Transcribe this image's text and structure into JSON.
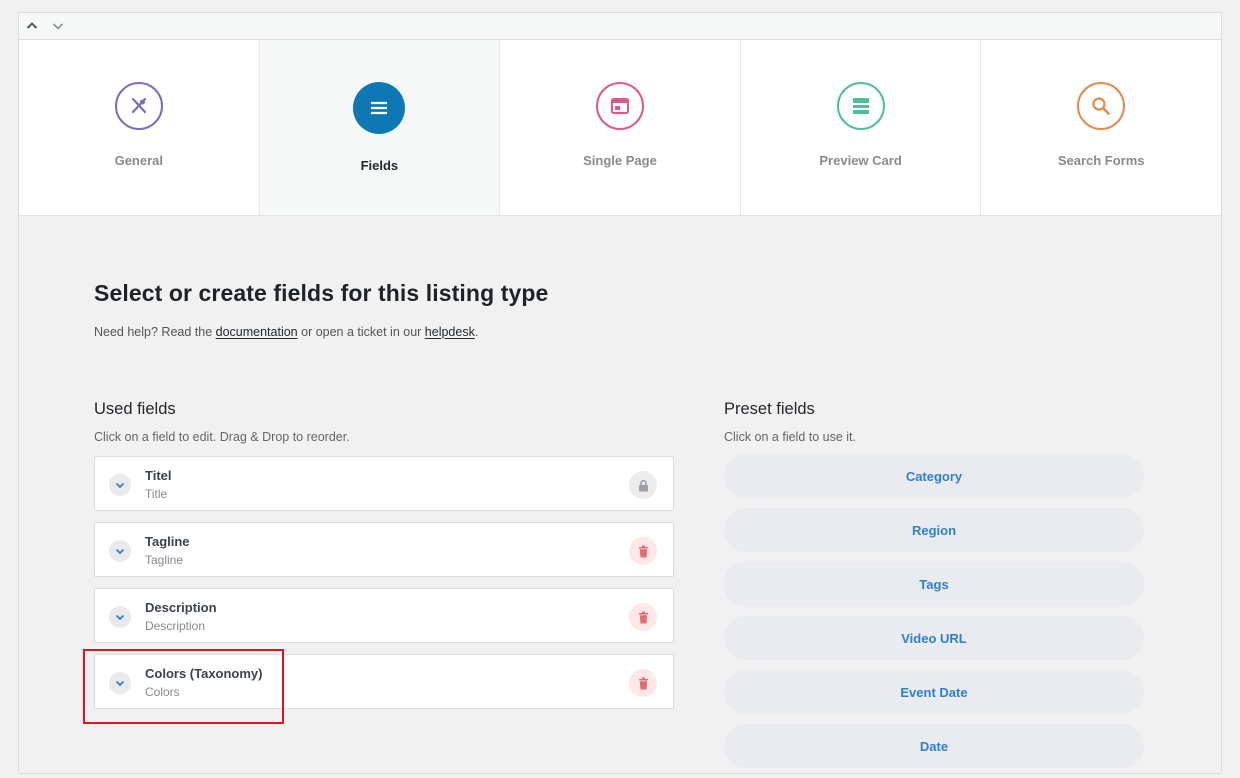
{
  "tabs": [
    {
      "label": "General",
      "icon": "utensils-icon",
      "color": "#7e6bc4",
      "active": false
    },
    {
      "label": "Fields",
      "icon": "list-icon",
      "color": "#0e78b4",
      "active": true
    },
    {
      "label": "Single Page",
      "icon": "browser-window-icon",
      "color": "#e0588a",
      "active": false
    },
    {
      "label": "Preview Card",
      "icon": "card-icon",
      "color": "#4dbf9c",
      "active": false
    },
    {
      "label": "Search Forms",
      "icon": "search-icon",
      "color": "#e8884a",
      "active": false
    }
  ],
  "heading": "Select or create fields for this listing type",
  "help": {
    "prefix": "Need help? Read the ",
    "doc_link": "documentation",
    "middle": " or open a ticket in our ",
    "helpdesk_link": "helpdesk",
    "suffix": "."
  },
  "used_fields": {
    "title": "Used fields",
    "hint": "Click on a field to edit. Drag & Drop to reorder.",
    "items": [
      {
        "label": "Titel",
        "key": "Title",
        "action": "lock"
      },
      {
        "label": "Tagline",
        "key": "Tagline",
        "action": "delete"
      },
      {
        "label": "Description",
        "key": "Description",
        "action": "delete"
      },
      {
        "label": "Colors (Taxonomy)",
        "key": "Colors",
        "action": "delete"
      }
    ]
  },
  "preset_fields": {
    "title": "Preset fields",
    "hint": "Click on a field to use it.",
    "items": [
      "Category",
      "Region",
      "Tags",
      "Video URL",
      "Event Date",
      "Date"
    ]
  },
  "colors": {
    "accent_blue": "#2f7fd1",
    "delete_red": "#e06c6c",
    "highlight_red": "#e0141e"
  }
}
